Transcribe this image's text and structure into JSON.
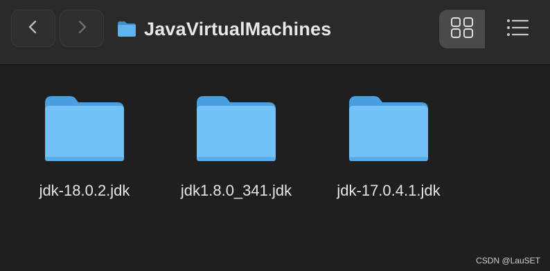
{
  "window": {
    "title": "JavaVirtualMachines"
  },
  "toolbar": {
    "back_icon": "chevron-left-icon",
    "forward_icon": "chevron-right-icon",
    "views": [
      {
        "name": "grid-view",
        "icon": "grid-icon",
        "active": true
      },
      {
        "name": "list-view",
        "icon": "list-icon",
        "active": false
      }
    ]
  },
  "files": [
    {
      "name": "jdk-18.0.2.jdk",
      "icon": "folder-icon"
    },
    {
      "name": "jdk1.8.0_341.jdk",
      "icon": "folder-icon"
    },
    {
      "name": "jdk-17.0.4.1.jdk",
      "icon": "folder-icon"
    }
  ],
  "watermark": "CSDN @LauSET",
  "colors": {
    "folder_back": "#4a9fe0",
    "folder_front": "#72c2f7",
    "background": "#1f1f1f",
    "toolbar": "#2a2a2a"
  }
}
